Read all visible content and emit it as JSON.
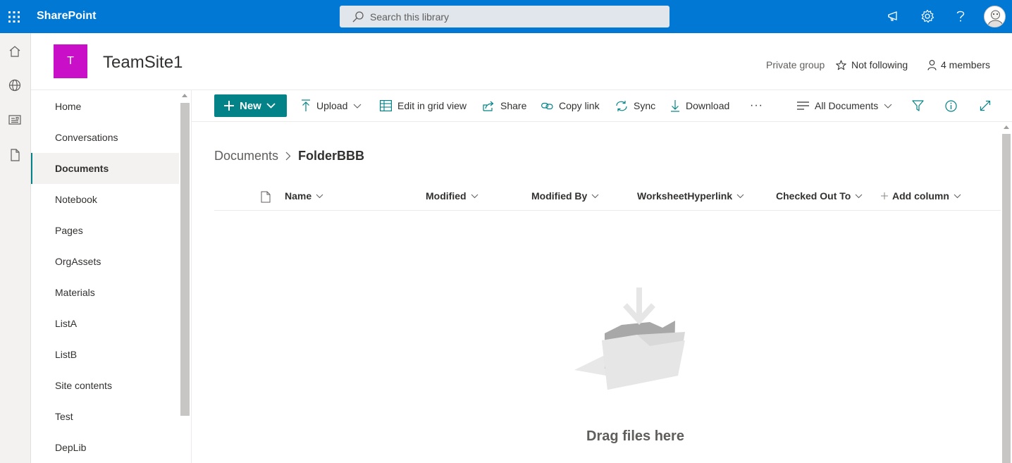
{
  "suite": {
    "app_name": "SharePoint",
    "search_placeholder": "Search this library"
  },
  "site": {
    "logo_letter": "T",
    "title": "TeamSite1",
    "privacy": "Private group",
    "follow": "Not following",
    "members": "4 members"
  },
  "nav": {
    "items": [
      {
        "label": "Home"
      },
      {
        "label": "Conversations"
      },
      {
        "label": "Documents",
        "active": true
      },
      {
        "label": "Notebook"
      },
      {
        "label": "Pages"
      },
      {
        "label": "OrgAssets"
      },
      {
        "label": "Materials"
      },
      {
        "label": "ListA"
      },
      {
        "label": "ListB"
      },
      {
        "label": "Site contents"
      },
      {
        "label": "Test"
      },
      {
        "label": "DepLib"
      }
    ]
  },
  "commands": {
    "new": "New",
    "upload": "Upload",
    "edit_grid": "Edit in grid view",
    "share": "Share",
    "copy_link": "Copy link",
    "sync": "Sync",
    "download": "Download",
    "more": "···",
    "view": "All Documents"
  },
  "breadcrumb": {
    "root": "Documents",
    "current": "FolderBBB"
  },
  "columns": {
    "name": "Name",
    "modified": "Modified",
    "modified_by": "Modified By",
    "worksheet": "WorksheetHyperlink",
    "checked_out": "Checked Out To",
    "add": "Add column"
  },
  "empty": {
    "message": "Drag files here"
  },
  "colors": {
    "suite_bar": "#0078d4",
    "accent": "#038387",
    "site_logo": "#c90fc7"
  }
}
